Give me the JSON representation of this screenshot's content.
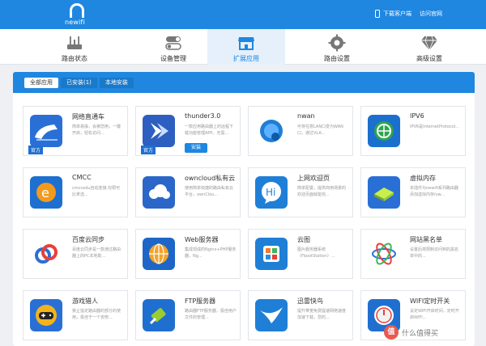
{
  "header": {
    "logo_text": "newifi",
    "download_client": "下载客户端",
    "visit_site": "访问官网"
  },
  "nav": [
    {
      "label": "路由状态",
      "icon": "router-icon"
    },
    {
      "label": "设备管理",
      "icon": "toggle-icon"
    },
    {
      "label": "扩展应用",
      "icon": "store-icon",
      "active": true
    },
    {
      "label": "路由设置",
      "icon": "gear-icon"
    },
    {
      "label": "高级设置",
      "icon": "diamond-icon"
    }
  ],
  "tabs": {
    "all": "全部应用",
    "installed": "已安装(1)",
    "local": "本地安装"
  },
  "apps": [
    {
      "name": "网络直通车",
      "desc": "简单易操，会被您用，一键开启，轻松访问...",
      "badge": "官方",
      "icon": "train-icon"
    },
    {
      "name": "thunder3.0",
      "desc": "一款应用路由器上的远程下载功能管理APP。无需...",
      "badge": "官方",
      "install": "安装",
      "icon": "thunder-icon"
    },
    {
      "name": "nwan",
      "desc": "可将任意LAN口变为WAN口，通过VLA...",
      "icon": "nwan-icon"
    },
    {
      "name": "IPV6",
      "desc": "IPV6是InternetProtocol...",
      "icon": "ipv6-icon"
    },
    {
      "name": "CMCC",
      "desc": "cmccedu自动连接,仅限可比拿选...",
      "icon": "cmcc-icon"
    },
    {
      "name": "owncloud私有云",
      "desc": "使用简单快捷的路由私有云平台，ownClou...",
      "icon": "owncloud-icon"
    },
    {
      "name": "上网欢迎页",
      "desc": "简单配置，提供商用场景的欢迎页面就能完...",
      "icon": "welcome-icon"
    },
    {
      "name": "虚拟内存",
      "desc": "本插件为newifi系列路由器添加虚拟内存(sw...",
      "icon": "memory-icon"
    },
    {
      "name": "百度云同步",
      "desc": "百度云同步是一款通过路由器上的PC本地助...",
      "icon": "baidu-icon"
    },
    {
      "name": "Web服务器",
      "desc": "集成现成的Nginx+PHP服务器，Ng...",
      "icon": "web-server-icon"
    },
    {
      "name": "云图",
      "desc": "图片服务器系统（FbootStation）...",
      "icon": "cloud-photo-icon"
    },
    {
      "name": "网站黑名单",
      "desc": "设置后将限制访问到的黑名单中的...",
      "icon": "blacklist-icon"
    },
    {
      "name": "游戏猎人",
      "desc": "禁止指定路由器的部分的使用，极佳于一个安修...",
      "icon": "game-icon"
    },
    {
      "name": "FTP服务器",
      "desc": "路由器FTP服务器，极佳用户文件的管理...",
      "icon": "ftp-icon"
    },
    {
      "name": "迅雷快鸟",
      "desc": "提升带宽免费提速网络速度加速下载，您的...",
      "icon": "swallow-icon"
    },
    {
      "name": "WIFI定时开关",
      "desc": "设定WIFI开启时间，定时开启WIFI...",
      "icon": "power-icon"
    }
  ],
  "watermark": {
    "glyph": "值",
    "text": "什么值得买"
  },
  "colors": {
    "brand": "#1f87e0",
    "badge": "#1f6fd0"
  }
}
